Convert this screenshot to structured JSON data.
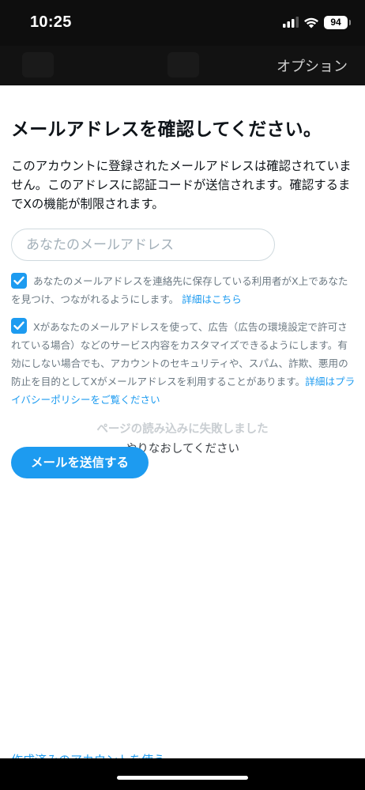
{
  "status_bar": {
    "time": "10:25",
    "battery": "94"
  },
  "nav": {
    "options_label": "オプション"
  },
  "main": {
    "title": "メールアドレスを確認してください。",
    "description": "このアカウントに登録されたメールアドレスは確認されていません。このアドレスに認証コードが送信されます。確認するまでXの機能が制限されます。",
    "email_placeholder": "あなたのメールアドレス",
    "option1": {
      "checked": true,
      "text": "あなたのメールアドレスを連絡先に保存している利用者がX上であなたを見つけ、つながれるようにします。",
      "link": "詳細はこちら"
    },
    "option2": {
      "checked": true,
      "text": "Xがあなたのメールアドレスを使って、広告（広告の環境設定で許可されている場合）などのサービス内容をカスタマイズできるようにします。有効にしない場合でも、アカウントのセキュリティや、スパム、詐欺、悪用の防止を目的としてXがメールアドレスを利用することがあります。",
      "link": "詳細はプライバシーポリシーをご覧ください"
    },
    "load_failed": "ページの読み込みに失敗しました",
    "retry": "やりなおしてください",
    "send_button": "メールを送信する"
  },
  "bottom": {
    "existing_account_link": "作成済みのアカウントを使う"
  },
  "colors": {
    "accent": "#1d9bf0",
    "text": "#0f1419",
    "muted": "#6b7882"
  }
}
